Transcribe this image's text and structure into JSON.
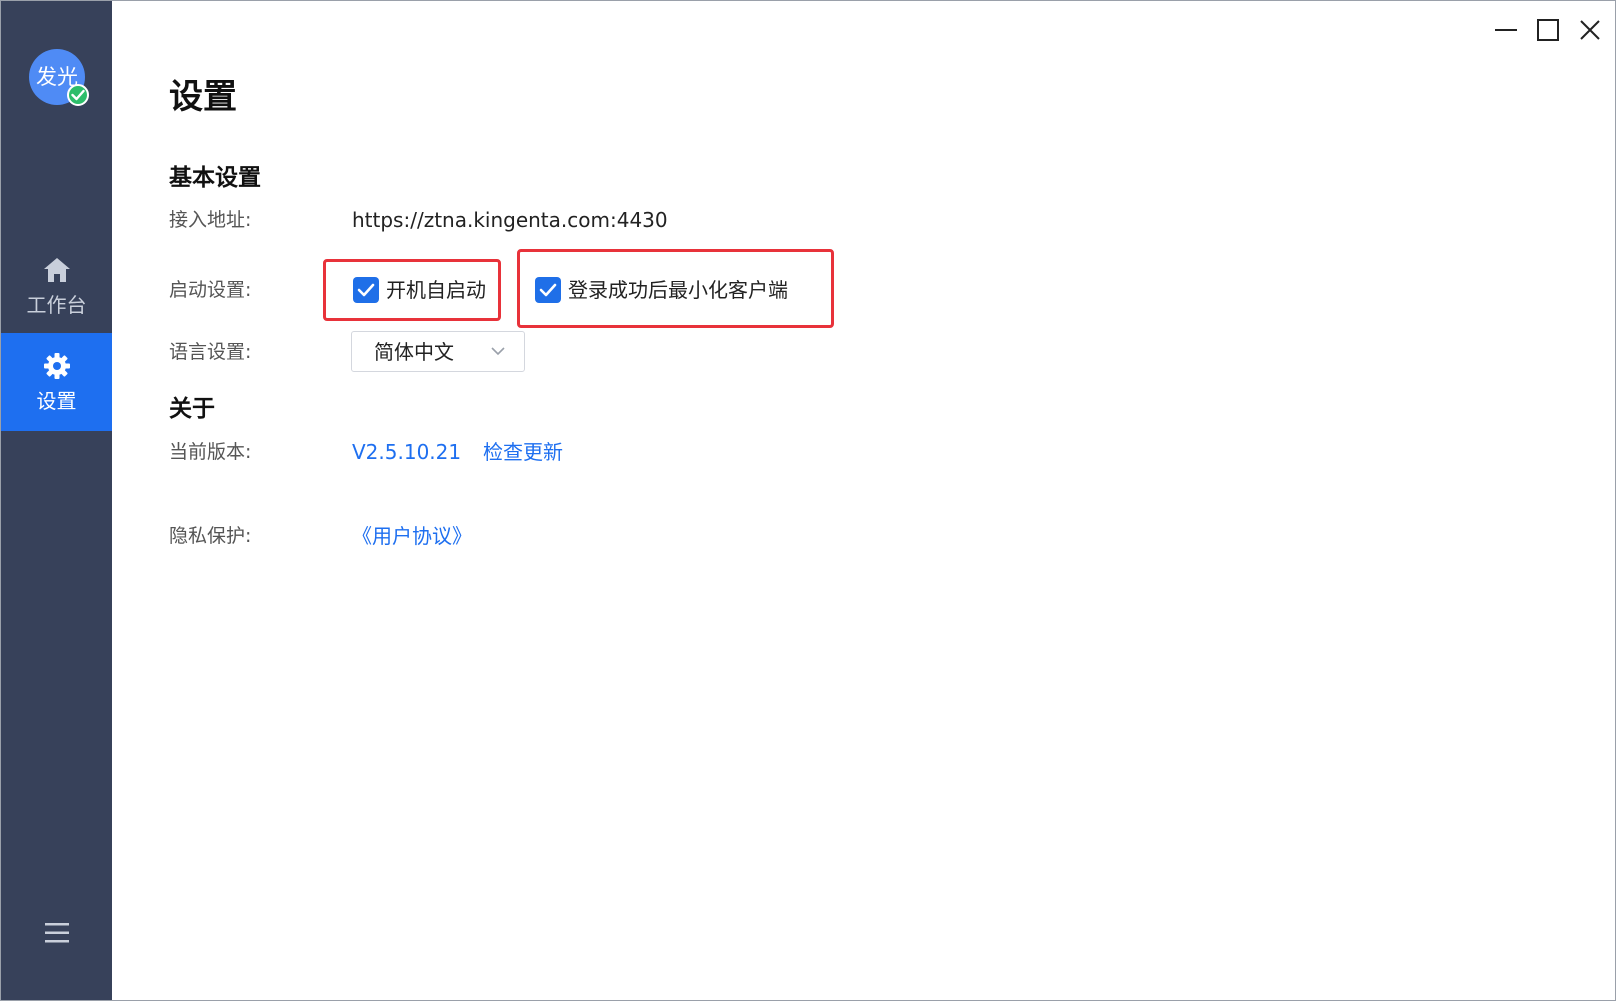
{
  "sidebar": {
    "avatar_text": "发光",
    "items": [
      {
        "label": "工作台",
        "icon": "home-icon"
      },
      {
        "label": "设置",
        "icon": "gear-icon"
      }
    ],
    "menu_icon": "menu-icon"
  },
  "window_controls": [
    "minimize-icon",
    "maximize-icon",
    "close-icon"
  ],
  "page": {
    "title": "设置"
  },
  "basic": {
    "title": "基本设置",
    "access_label": "接入地址:",
    "access_value": "https://ztna.kingenta.com:4430",
    "startup_label": "启动设置:",
    "autostart_label": "开机自启动",
    "autostart_checked": true,
    "minimize_label": "登录成功后最小化客户端",
    "minimize_checked": true,
    "language_label": "语言设置:",
    "language_value": "简体中文"
  },
  "about": {
    "title": "关于",
    "version_label": "当前版本:",
    "version_value": "V2.5.10.21",
    "check_update": "检查更新",
    "privacy_label": "隐私保护:",
    "privacy_link": "《用户协议》"
  },
  "colors": {
    "sidebar_bg": "#37415a",
    "accent": "#1e6ff0",
    "highlight": "#e8323a",
    "badge": "#2dbd6a"
  }
}
